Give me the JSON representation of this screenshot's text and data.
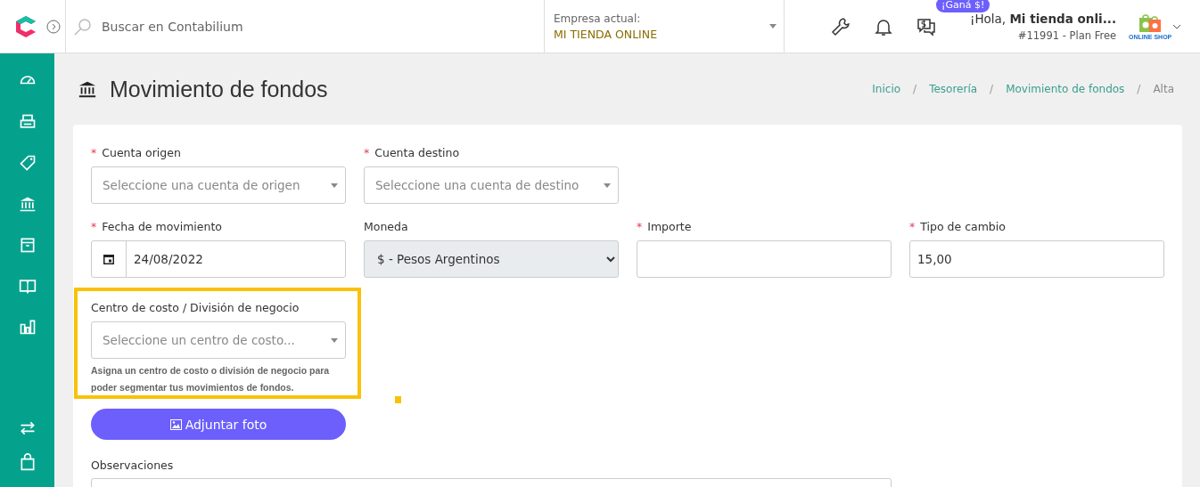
{
  "topbar": {
    "search": {
      "placeholder": "Buscar en Contabilium"
    },
    "company": {
      "label": "Empresa actual:",
      "value": "MI TIENDA ONLINE"
    },
    "badge": "¡Ganá $!",
    "greeting": "¡Hola, **Mi tienda onli...**",
    "plan": "#11991 - Plan Free",
    "avatar_caption": "ONLINE SHOP"
  },
  "page": {
    "title": "Movimiento de fondos",
    "breadcrumb": [
      {
        "kind": "link",
        "label": "Inicio"
      },
      {
        "kind": "separator",
        "label": "/"
      },
      {
        "kind": "link",
        "label": "Tesorería"
      },
      {
        "kind": "separator",
        "label": "/"
      },
      {
        "kind": "link",
        "label": "Movimiento de fondos"
      },
      {
        "kind": "separator",
        "label": "/"
      },
      {
        "kind": "current",
        "label": "Alta"
      }
    ]
  },
  "form": {
    "rows": [
      [
        {
          "kind": "select",
          "required_mark": "*",
          "label": "Cuenta origen",
          "placeholder": "Seleccione una cuenta de origen"
        },
        {
          "kind": "select",
          "required_mark": "*",
          "label": "Cuenta destino",
          "placeholder": "Seleccione una cuenta de destino"
        }
      ],
      [
        {
          "kind": "date",
          "required_mark": "*",
          "label": "Fecha de movimiento",
          "value": "24/08/2022"
        },
        {
          "kind": "native-select",
          "label": "Moneda",
          "value": "$ - Pesos Argentinos"
        },
        {
          "kind": "text",
          "required_mark": "*",
          "label": "Importe"
        },
        {
          "kind": "text",
          "required_mark": "*",
          "label": "Tipo de cambio",
          "value": "15,00"
        }
      ]
    ],
    "cost_center": {
      "label": "Centro de costo / División de negocio",
      "placeholder": "Seleccione un centro de costo...",
      "help": "Asigna un centro de costo o división de negocio para poder segmentar tus movimientos de fondos.",
      "highlighted": true
    },
    "attach_button": "Adjuntar foto",
    "notes": {
      "label": "Observaciones"
    }
  }
}
